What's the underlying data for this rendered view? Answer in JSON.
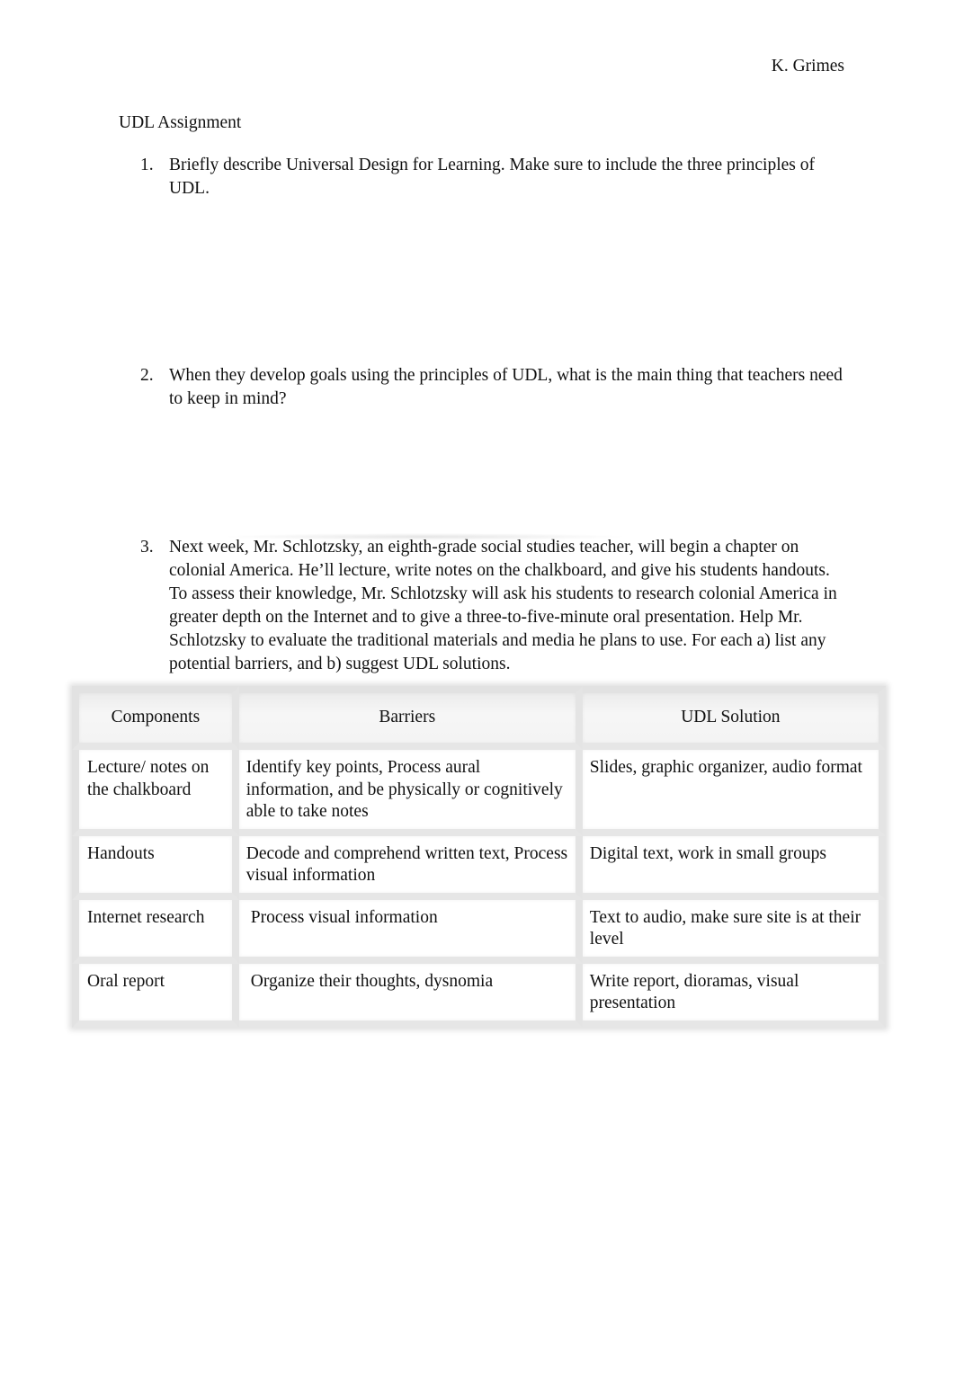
{
  "header": {
    "author": "K. Grimes",
    "title": "UDL Assignment"
  },
  "questions": [
    {
      "number": "1.",
      "text": "Briefly describe Universal Design for Learning. Make sure to include the three principles of UDL."
    },
    {
      "number": "2.",
      "text": "When they develop goals using the principles of UDL, what is the main thing that teachers need to keep in mind?"
    },
    {
      "number": "3.",
      "text": "Next week, Mr. Schlotzsky, an eighth-grade social studies teacher, will begin a chapter on colonial America. He’ll lecture, write notes on the chalkboard, and give his students handouts. To assess their knowledge, Mr. Schlotzsky will ask his students to research colonial America in greater depth on the Internet and to give a three-to-five-minute oral presentation. Help Mr. Schlotzsky to evaluate the traditional materials and media he plans to use. For each a) list any potential barriers, and b) suggest UDL solutions."
    }
  ],
  "table": {
    "headers": [
      "Components",
      "Barriers",
      "UDL Solution"
    ],
    "rows": [
      [
        "Lecture/ notes on the chalkboard",
        "Identify key points, Process aural information, and be physically or cognitively able to take notes",
        "Slides, graphic organizer, audio format"
      ],
      [
        "Handouts",
        "Decode and comprehend written text, Process visual information",
        "Digital text, work in small groups"
      ],
      [
        "Internet research",
        "Process visual information",
        "Text to audio, make sure site is at their level"
      ],
      [
        "Oral report",
        "Organize their thoughts, dysnomia",
        "Write report, dioramas, visual presentation"
      ]
    ]
  }
}
